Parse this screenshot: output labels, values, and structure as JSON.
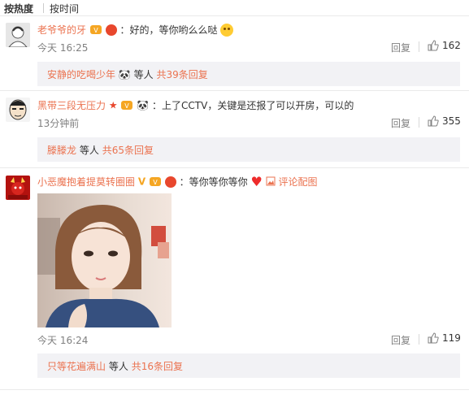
{
  "sort": {
    "hot": "按热度",
    "time": "按时间"
  },
  "comments": [
    {
      "author": "老爷爷的牙",
      "text": "：好的，等你哟么么哒",
      "time": "今天 16:25",
      "reply": "回复",
      "likes": "162",
      "replies": {
        "user": "安静的吃喝少年",
        "suffix": "等人",
        "count": "共39条回复"
      }
    },
    {
      "author": "黑带三段无压力",
      "text": "：上了CCTV，关键是还报了可以开房，可以的",
      "time": "13分钟前",
      "reply": "回复",
      "likes": "355",
      "replies": {
        "user": "滕滕龙",
        "suffix": "等人",
        "count": "共65条回复"
      }
    },
    {
      "author": "小恶魔抱着提莫转圈圈",
      "text": "：等你等你等你",
      "pic_link": "评论配图",
      "time": "今天 16:24",
      "reply": "回复",
      "likes": "119",
      "replies": {
        "user": "只等花遍满山",
        "suffix": "等人",
        "count": "共16条回复"
      }
    }
  ],
  "colors": {
    "link": "#eb7350",
    "reply_bg": "#f2f2f5",
    "meta": "#808080"
  }
}
